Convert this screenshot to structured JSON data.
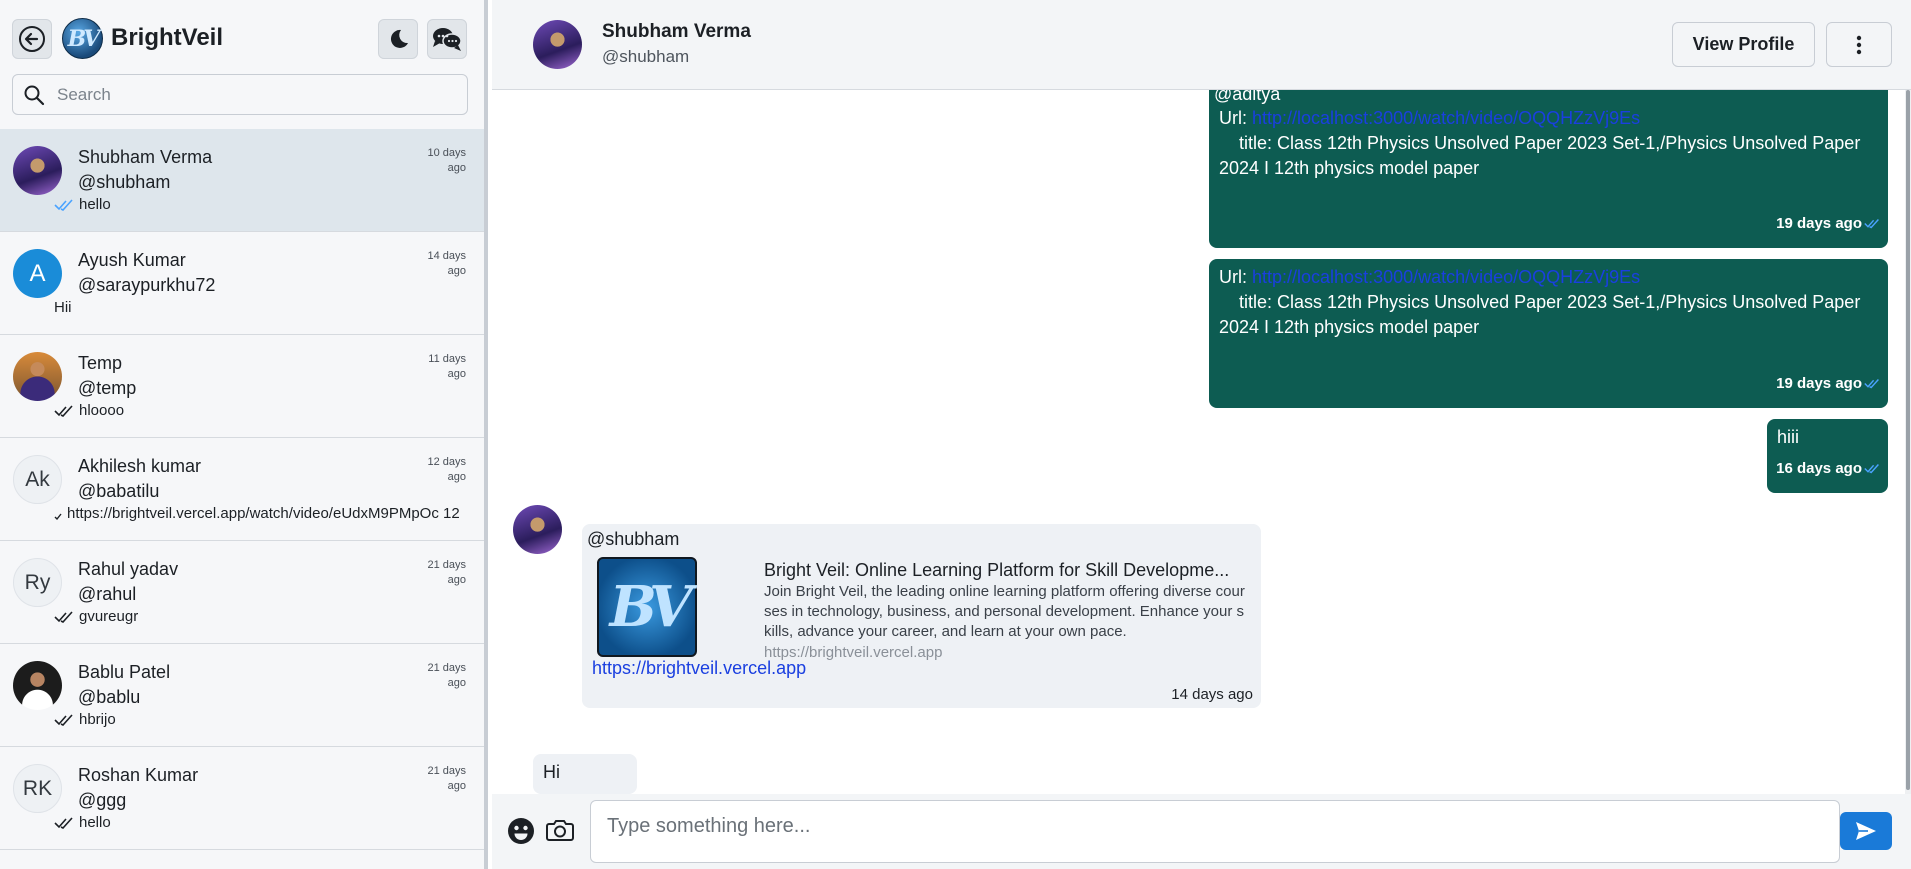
{
  "app": {
    "brand_name": "BrightVeil",
    "logo_text": "BV"
  },
  "search": {
    "placeholder": "Search",
    "value": ""
  },
  "contacts": [
    {
      "name": "Shubham Verma",
      "handle": "@shubham",
      "last_message": "hello",
      "time": "10 days ago",
      "read": true,
      "active": true,
      "avatar": "photo"
    },
    {
      "name": "Ayush Kumar",
      "handle": "@saraypurkhu72",
      "last_message": "Hii",
      "time": "14 days ago",
      "avatar_letter": "A"
    },
    {
      "name": "Temp",
      "handle": "@temp",
      "last_message": "hloooo",
      "time": "11 days ago",
      "avatar": "photo"
    },
    {
      "name": "Akhilesh kumar",
      "handle": "@babatilu",
      "last_message": "https://brightveil.vercel.app/watch/video/eUdxM9PMpOc 12",
      "time": "12 days ago",
      "avatar_letter": "Ak"
    },
    {
      "name": "Rahul yadav",
      "handle": "@rahul",
      "last_message": "gvureugr",
      "time": "21 days ago",
      "avatar_letter": "Ry"
    },
    {
      "name": "Bablu Patel",
      "handle": "@bablu",
      "last_message": "hbrijo",
      "time": "21 days ago",
      "avatar": "photo"
    },
    {
      "name": "Roshan Kumar",
      "handle": "@ggg",
      "last_message": "hello",
      "time": "21 days ago",
      "avatar_letter": "RK"
    }
  ],
  "chat_header": {
    "name": "Shubham Verma",
    "handle": "@shubham",
    "view_profile_label": "View Profile"
  },
  "messages": {
    "msg1": {
      "mention": "@aditya",
      "url_label": "Url: ",
      "url": "http://localhost:3000/watch/video/OQQHZzVj9Es",
      "title_line": "title: Class 12th Physics Unsolved Paper 2023 Set-1,/Physics Unsolved Paper 2024  I 12th physics model paper",
      "time": "19 days ago"
    },
    "msg2": {
      "url_label": "Url: ",
      "url": "http://localhost:3000/watch/video/OQQHZzVj9Es",
      "title_line": "title: Class 12th Physics Unsolved Paper 2023 Set-1,/Physics Unsolved Paper 2024  I 12th physics model paper",
      "time": "19 days ago"
    },
    "msg3": {
      "text": "hiii",
      "time": "16 days ago"
    },
    "msg4": {
      "sender": "@shubham",
      "preview_title": "Bright Veil: Online Learning Platform for Skill Developme...",
      "preview_description": "Join Bright Veil, the leading online learning platform offering diverse courses in technology, business, and personal development. Enhance your skills, advance your career, and learn at your own pace.",
      "preview_domain": "https://brightveil.vercel.app",
      "link": "https://brightveil.vercel.app",
      "time": "14 days ago"
    },
    "msg5": {
      "text": "Hi"
    }
  },
  "composer": {
    "placeholder": "Type something here...",
    "value": ""
  },
  "colors": {
    "outgoing_bubble": "#0d5c52",
    "accent": "#1a7ad8",
    "link": "#1a3fe0",
    "read_tick": "#4aa3ff"
  }
}
